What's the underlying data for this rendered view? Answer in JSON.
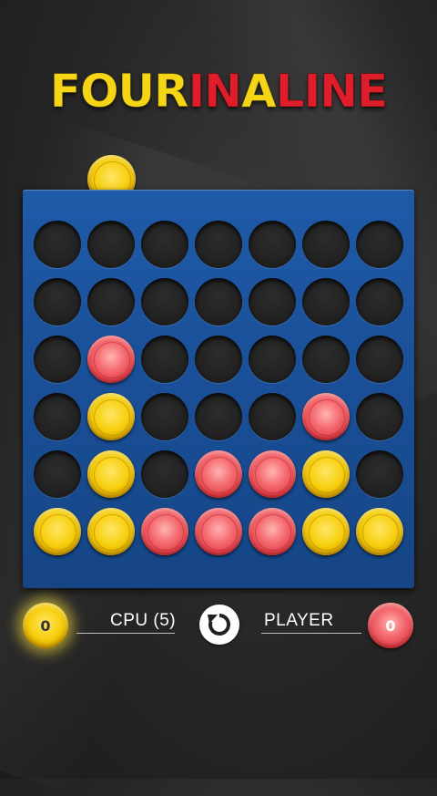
{
  "title": {
    "four": "FOUR",
    "in": "IN",
    "a": "A",
    "line": "LINE"
  },
  "colors": {
    "board": "#1a4f97",
    "yellow": "#f7d010",
    "red": "#e2434c",
    "background": "#262626"
  },
  "current_piece": "yellow",
  "hover_column": 2,
  "board": {
    "columns": 7,
    "rows": 6,
    "grid": [
      [
        "empty",
        "empty",
        "empty",
        "empty",
        "empty",
        "empty",
        "empty"
      ],
      [
        "empty",
        "empty",
        "empty",
        "empty",
        "empty",
        "empty",
        "empty"
      ],
      [
        "empty",
        "red",
        "empty",
        "empty",
        "empty",
        "empty",
        "empty"
      ],
      [
        "empty",
        "yellow",
        "empty",
        "empty",
        "empty",
        "red",
        "empty"
      ],
      [
        "empty",
        "yellow",
        "empty",
        "red",
        "red",
        "yellow",
        "empty"
      ],
      [
        "yellow",
        "yellow",
        "red",
        "red",
        "red",
        "yellow",
        "yellow"
      ]
    ]
  },
  "scoreboard": {
    "cpu_score": "0",
    "cpu_label": "CPU (5)",
    "player_label": "PLAYER",
    "player_score": "0",
    "restart_icon": "restart-icon"
  }
}
